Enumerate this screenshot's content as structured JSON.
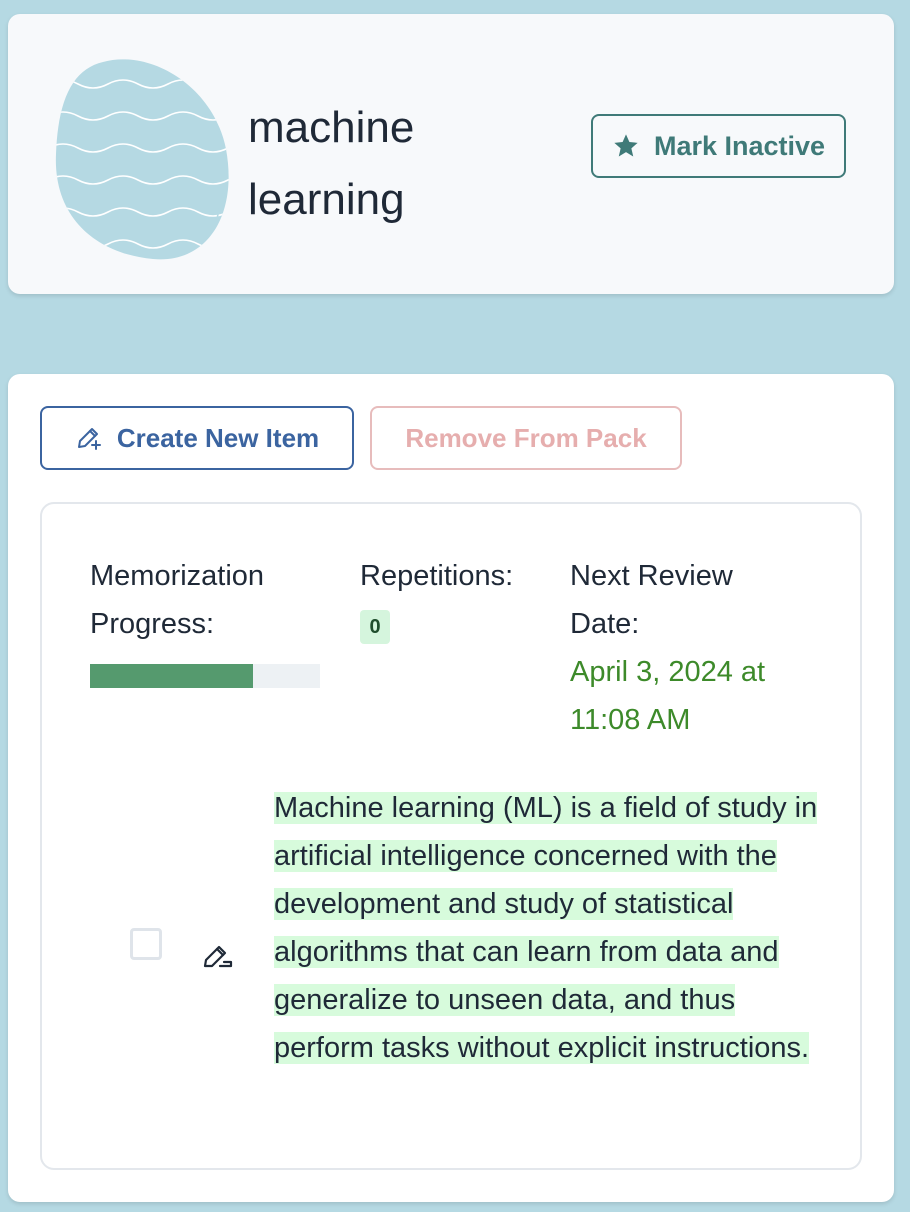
{
  "header": {
    "title_line1": "machine",
    "title_line2": "learning",
    "mark_inactive_label": "Mark Inactive"
  },
  "toolbar": {
    "create_label": "Create New Item",
    "remove_label": "Remove From Pack"
  },
  "item": {
    "progress_label_line1": "Memorization",
    "progress_label_line2": "Progress:",
    "progress_fraction": 0.71,
    "repetitions_label": "Repetitions:",
    "repetitions_value": "0",
    "next_review_line1": "Next Review",
    "next_review_line2": "Date:",
    "next_review_value_line1": "April 3, 2024 at",
    "next_review_value_line2": "11:08 AM",
    "text": "Machine learning (ML) is a field of study in artificial intelligence concerned with the development and study of statistical algorithms that can learn from data and generalize to unseen data, and thus perform tasks without explicit instructions."
  },
  "colors": {
    "background": "#b5d9e3",
    "teal_accent": "#3f7a78",
    "blue_accent": "#3b64a0",
    "remove_disabled": "#e6aeae",
    "progress_fill": "#559a6e",
    "date_green": "#3d8a2a",
    "highlight": "#d7fbdc"
  },
  "icons": {
    "logo": "wavy-blob-icon",
    "mark_inactive": "star-icon",
    "create": "pencil-plus-icon",
    "edit": "pencil-edit-icon"
  }
}
